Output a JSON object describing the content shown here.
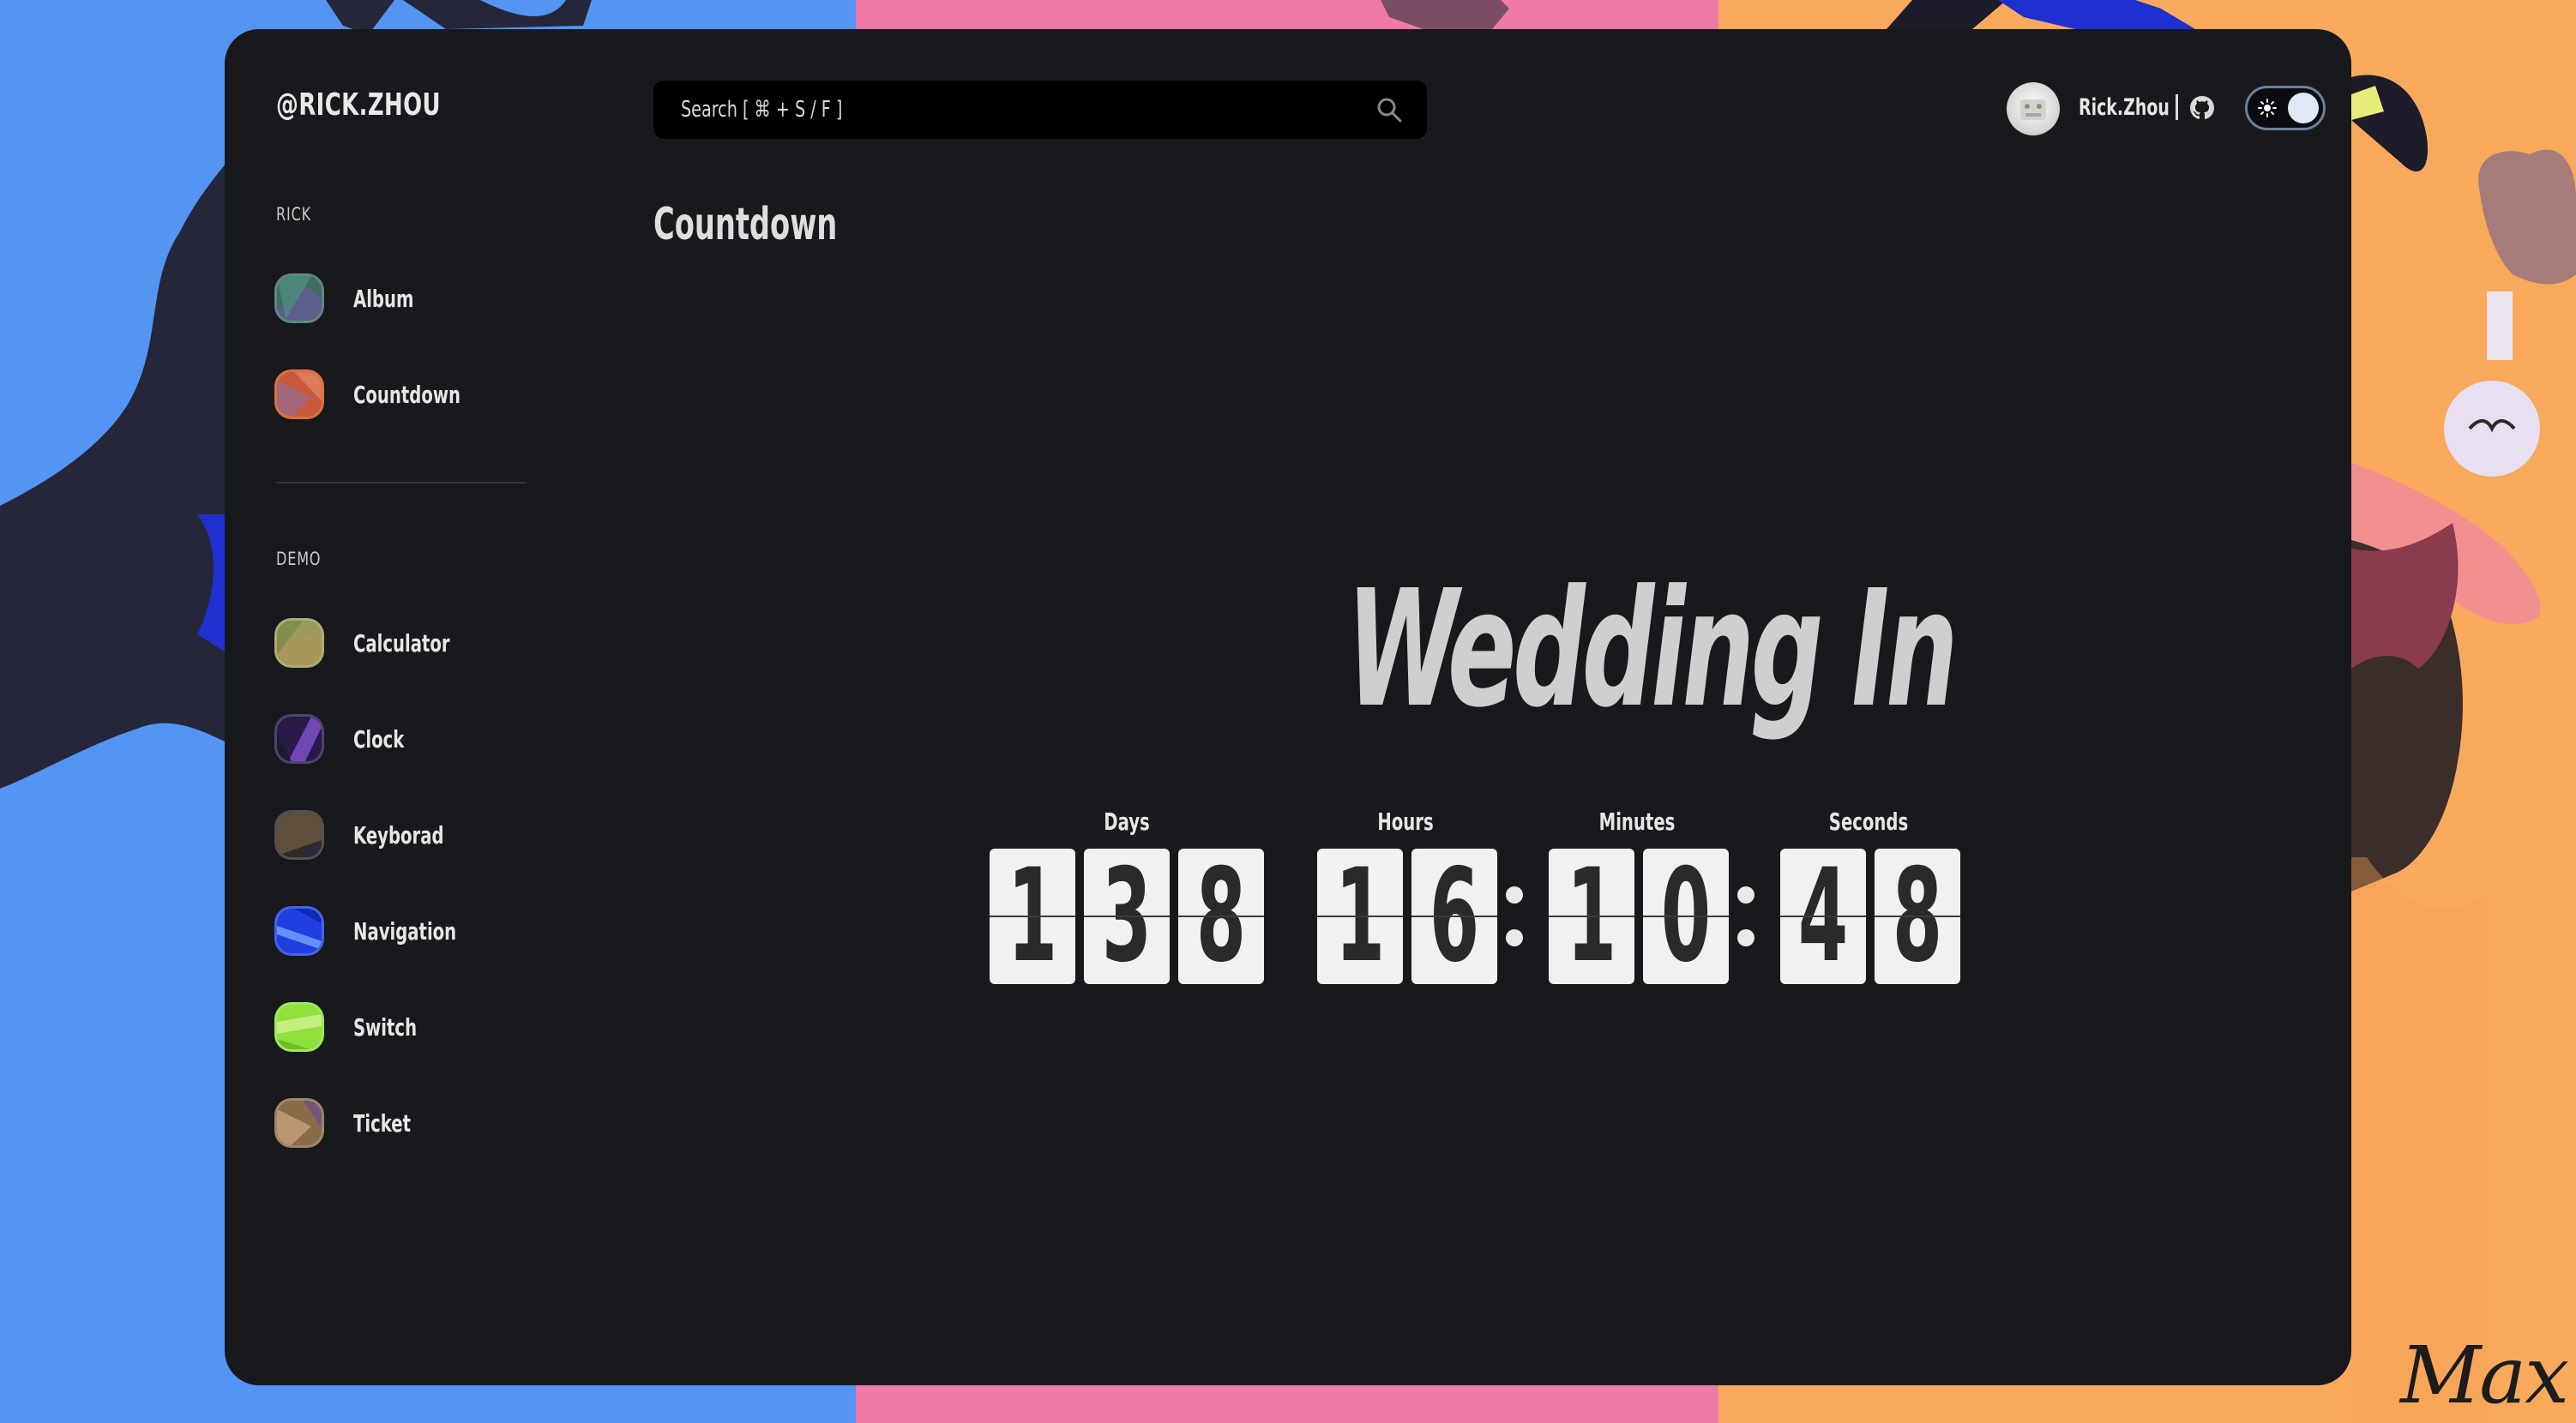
{
  "brand": "@RICK.ZHOU",
  "sidebar": {
    "sections": [
      {
        "label": "RICK",
        "items": [
          {
            "label": "Album",
            "icon": "album-icon",
            "color": "#3f6d63"
          },
          {
            "label": "Countdown",
            "icon": "countdown-icon",
            "color": "#c65a3b"
          }
        ]
      },
      {
        "label": "DEMO",
        "items": [
          {
            "label": "Calculator",
            "icon": "calculator-icon",
            "color": "#9a9a5c"
          },
          {
            "label": "Clock",
            "icon": "clock-icon",
            "color": "#4b2f86"
          },
          {
            "label": "Keyborad",
            "icon": "keyboard-icon",
            "color": "#4a4238"
          },
          {
            "label": "Navigation",
            "icon": "navigation-icon",
            "color": "#1f3fe0"
          },
          {
            "label": "Switch",
            "icon": "switch-icon",
            "color": "#8fe03a"
          },
          {
            "label": "Ticket",
            "icon": "ticket-icon",
            "color": "#8a6b4a"
          }
        ]
      }
    ]
  },
  "search": {
    "placeholder": "Search [ ⌘ + S / F ]",
    "icon": "search-icon"
  },
  "user": {
    "name": "Rick.Zhou",
    "avatar": "avatar"
  },
  "header_icons": {
    "github": "github-icon",
    "theme": "sun-icon"
  },
  "page_title": "Countdown",
  "countdown": {
    "title": "Wedding In",
    "units": [
      {
        "label": "Days",
        "digits": [
          "1",
          "3",
          "8"
        ]
      },
      {
        "label": "Hours",
        "digits": [
          "1",
          "6"
        ]
      },
      {
        "label": "Minutes",
        "digits": [
          "1",
          "0"
        ]
      },
      {
        "label": "Seconds",
        "digits": [
          "4",
          "8"
        ]
      }
    ]
  },
  "wallpaper_signature": "Max",
  "colors": {
    "window_bg": "#18191d",
    "wallpaper_blue": "#5494f2",
    "wallpaper_pink": "#ef7aa8",
    "wallpaper_orange": "#f8a95c",
    "digit_card": "#f1f1f1",
    "digit_text": "#2a2a2a"
  }
}
